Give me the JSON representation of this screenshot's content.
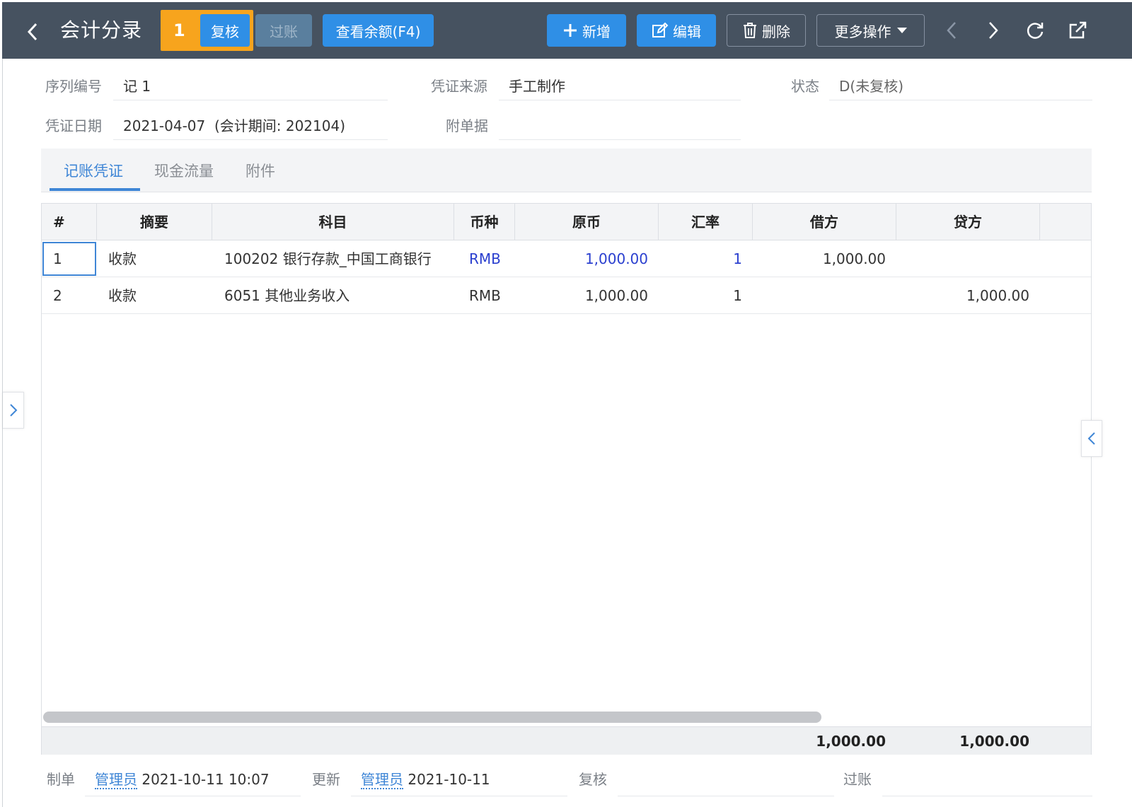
{
  "header": {
    "title": "会计分录",
    "callout_number": "1",
    "buttons": {
      "review": "复核",
      "post": "过账",
      "view_balance": "查看余额(F4)",
      "add": "新增",
      "edit": "编辑",
      "delete": "删除",
      "more": "更多操作"
    }
  },
  "form": {
    "serial_no": {
      "label": "序列编号",
      "value": "记 1"
    },
    "voucher_source": {
      "label": "凭证来源",
      "value": "手工制作"
    },
    "status": {
      "label": "状态",
      "value": "D(未复核)"
    },
    "voucher_date": {
      "label": "凭证日期",
      "value": "2021-04-07  (会计期间: 202104)"
    },
    "attachments": {
      "label": "附单据",
      "value": ""
    }
  },
  "tabs": [
    {
      "label": "记账凭证",
      "active": true
    },
    {
      "label": "现金流量",
      "active": false
    },
    {
      "label": "附件",
      "active": false
    }
  ],
  "table": {
    "headers": [
      "#",
      "摘要",
      "科目",
      "币种",
      "原币",
      "汇率",
      "借方",
      "贷方"
    ],
    "rows": [
      {
        "no": "1",
        "summary": "收款",
        "account": "100202 银行存款_中国工商银行",
        "currency": "RMB",
        "original": "1,000.00",
        "rate": "1",
        "debit": "1,000.00",
        "credit": ""
      },
      {
        "no": "2",
        "summary": "收款",
        "account": "6051 其他业务收入",
        "currency": "RMB",
        "original": "1,000.00",
        "rate": "1",
        "debit": "",
        "credit": "1,000.00"
      }
    ],
    "totals": {
      "debit": "1,000.00",
      "credit": "1,000.00"
    }
  },
  "footer": {
    "maker_label": "制单",
    "maker_user": "管理员",
    "maker_time": "2021-10-11 10:07",
    "update_label": "更新",
    "update_user": "管理员",
    "update_time": "2021-10-11",
    "review_label": "复核",
    "post_label": "过账"
  },
  "colors": {
    "header_bg": "#465260",
    "primary": "#2f8fe6",
    "callout": "#f7a41d",
    "link": "#3f86d6",
    "highlight_text": "#2a3fcf"
  }
}
